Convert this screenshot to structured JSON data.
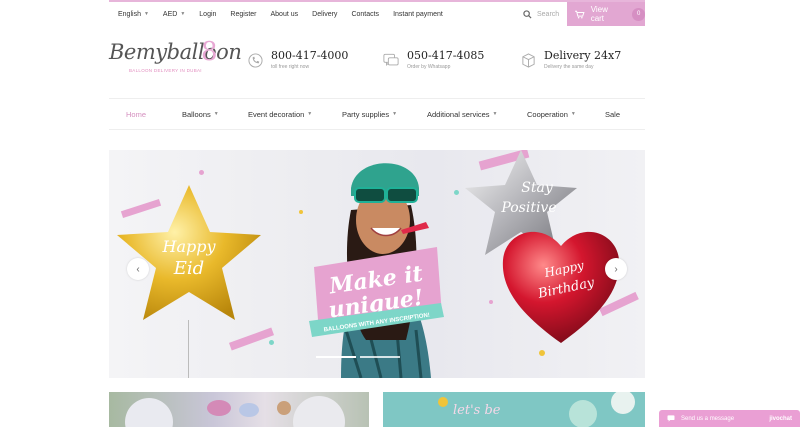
{
  "topbar": {
    "items": [
      {
        "label": "English",
        "caret": true
      },
      {
        "label": "AED",
        "caret": true
      },
      {
        "label": "Login"
      },
      {
        "label": "Register"
      },
      {
        "label": "About us"
      },
      {
        "label": "Delivery"
      },
      {
        "label": "Contacts"
      },
      {
        "label": "Instant payment"
      }
    ],
    "search_placeholder": "Search",
    "cart_label": "View cart",
    "cart_count": "0"
  },
  "logo": {
    "text": "Bemyballoon",
    "tagline": "BALLOON DELIVERY IN DUBAI"
  },
  "contacts": [
    {
      "main": "800-417-4000",
      "sub": "toll free right now",
      "icon": "phone-icon"
    },
    {
      "main": "050-417-4085",
      "sub": "Order by Whatsapp",
      "icon": "chat-icon"
    },
    {
      "main": "Delivery 24x7",
      "sub": "Delivery the same day",
      "icon": "box-icon"
    }
  ],
  "mainnav": [
    {
      "label": "Home",
      "active": true
    },
    {
      "label": "Balloons",
      "caret": true
    },
    {
      "label": "Event decoration",
      "caret": true
    },
    {
      "label": "Party supplies",
      "caret": true
    },
    {
      "label": "Additional services",
      "caret": true
    },
    {
      "label": "Cooperation",
      "caret": true
    },
    {
      "label": "Sale"
    }
  ],
  "slider": {
    "headline_1": "Make it",
    "headline_2": "unique!",
    "ribbon": "BALLOONS WITH ANY INSCRIPTION!",
    "star_text_1": "Happy",
    "star_text_2": "Eid",
    "heart_text_1": "Happy",
    "heart_text_2": "Birthday",
    "silver_text_1": "Stay",
    "silver_text_2": "Positive",
    "prev": "‹",
    "next": "›",
    "colors": {
      "pink": "#e6a3d0",
      "teal": "#7dd6c8",
      "gold": "#f0c43a",
      "red": "#c8152c"
    }
  },
  "bottom": {
    "banner_text": "let's be"
  },
  "chat": {
    "label": "Send us a message",
    "brand": "jivochat"
  }
}
